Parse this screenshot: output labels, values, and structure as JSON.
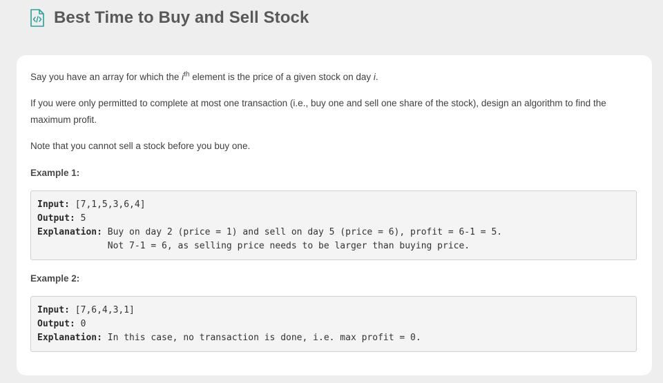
{
  "header": {
    "title": "Best Time to Buy and Sell Stock",
    "icon": "code-file-icon",
    "icon_color": "#2aa198"
  },
  "description": {
    "p1_before": "Say you have an array for which the ",
    "p1_var": "i",
    "p1_sup": "th",
    "p1_middle": " element is the price of a given stock on day ",
    "p1_var2": "i",
    "p1_end": ".",
    "p2": "If you were only permitted to complete at most one transaction (i.e., buy one and sell one share of the stock), design an algorithm to find the maximum profit.",
    "p3": "Note that you cannot sell a stock before you buy one."
  },
  "examples": [
    {
      "heading": "Example 1:",
      "input_label": "Input:",
      "input_value": " [7,1,5,3,6,4]",
      "output_label": "Output:",
      "output_value": " 5",
      "explanation_label": "Explanation:",
      "explanation_line1": " Buy on day 2 (price = 1) and sell on day 5 (price = 6), profit = 6-1 = 5.",
      "explanation_line2": "             Not 7-1 = 6, as selling price needs to be larger than buying price."
    },
    {
      "heading": "Example 2:",
      "input_label": "Input:",
      "input_value": " [7,6,4,3,1]",
      "output_label": "Output:",
      "output_value": " 0",
      "explanation_label": "Explanation:",
      "explanation_line1": " In this case, no transaction is done, i.e. max profit = 0."
    }
  ]
}
